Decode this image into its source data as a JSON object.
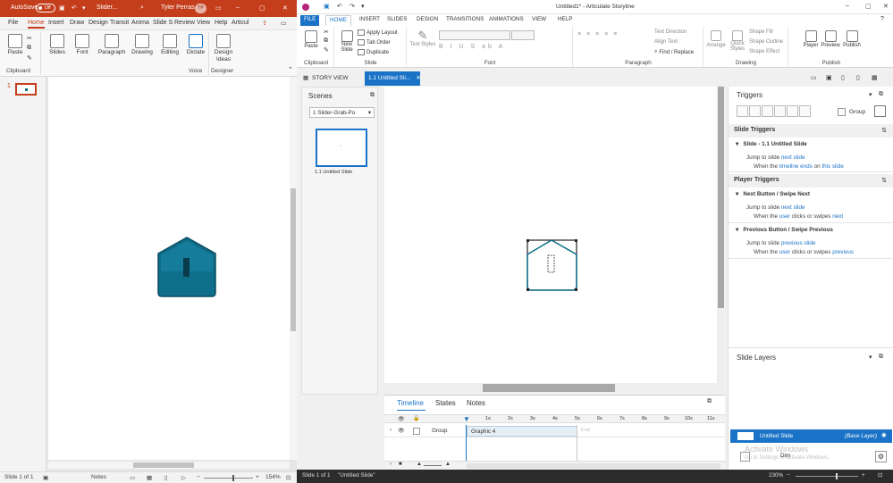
{
  "pp": {
    "titlebar": {
      "autosave": "AutoSave",
      "autosave_state": "Off",
      "doc": "Slider...",
      "user": "Tyler Perras",
      "initials": "TP"
    },
    "tabs": [
      "File",
      "Home",
      "Insert",
      "Draw",
      "Design",
      "Transit",
      "Anima",
      "Slide S",
      "Review",
      "View",
      "Help",
      "Articul"
    ],
    "active_tab": "Home",
    "ribbon": {
      "paste": "Paste",
      "clipboard": "Clipboard",
      "slides": "Slides",
      "font": "Font",
      "paragraph": "Paragraph",
      "drawing": "Drawing",
      "editing": "Editing",
      "dictate": "Dictate",
      "voice": "Voice",
      "design_ideas_1": "Design",
      "design_ideas_2": "Ideas",
      "designer": "Designer"
    },
    "thumb_number": "1",
    "status": {
      "slide": "Slide 1 of 1",
      "notes": "Notes",
      "zoom": "154%"
    },
    "shape_color": "#0f6e8a"
  },
  "sl": {
    "title": "Untitled1* - Articulate Storyline",
    "tabs": [
      "FILE",
      "HOME",
      "INSERT",
      "SLIDES",
      "DESIGN",
      "TRANSITIONS",
      "ANIMATIONS",
      "VIEW",
      "HELP"
    ],
    "active_tab": "HOME",
    "ribbon": {
      "paste": "Paste",
      "clipboard": "Clipboard",
      "new_slide_1": "New",
      "new_slide_2": "Slide",
      "apply_layout": "Apply Layout",
      "tab_order": "Tab Order",
      "duplicate": "Duplicate",
      "slide": "Slide",
      "text_styles": "Text Styles",
      "font": "Font",
      "text_direction": "Text Direction",
      "align_text": "Align Text",
      "find_replace": "Find / Replace",
      "paragraph": "Paragraph",
      "arrange": "Arrange",
      "quick_styles_1": "Quick",
      "quick_styles_2": "Styles",
      "shape_fill": "Shape Fill",
      "shape_outline": "Shape Outline",
      "shape_effect": "Shape Effect",
      "drawing": "Drawing",
      "player": "Player",
      "preview": "Preview",
      "publish_btn": "Publish",
      "publish": "Publish"
    },
    "view_tabs": {
      "story": "STORY VIEW",
      "slide": "1.1 Untitled Sli..."
    },
    "scenes": {
      "title": "Scenes",
      "dropdown": "1 Slider-Grab-Po",
      "thumb_label": "1.1 Untitled Slide"
    },
    "timeline": {
      "tabs": [
        "Timeline",
        "States",
        "Notes"
      ],
      "ticks": [
        "1s",
        "2s",
        "3s",
        "4s",
        "5s",
        "6s",
        "7s",
        "8s",
        "9s",
        "10s",
        "11s"
      ],
      "rows": [
        {
          "name": "Group",
          "bar": "Graphic 4"
        }
      ],
      "end": "End"
    },
    "triggers": {
      "title": "Triggers",
      "group": "Group",
      "slide_triggers": "Slide Triggers",
      "slide_sub": "Slide - 1.1 Untitled Slide",
      "t1_a": "Jump to slide",
      "t1_link": "next slide",
      "t1_b": "When the",
      "t1_link2": "timeline ends",
      "t1_c": "on",
      "t1_link3": "this slide",
      "player_triggers": "Player Triggers",
      "next_sub": "Next Button / Swipe Next",
      "t2_a": "Jump to slide",
      "t2_link": "next slide",
      "t2_b": "When the",
      "t2_link2": "user",
      "t2_c": "clicks or swipes",
      "t2_link3": "next",
      "prev_sub": "Previous Button / Swipe Previous",
      "t3_a": "Jump to slide",
      "t3_link": "previous slide",
      "t3_b": "When the",
      "t3_link2": "user",
      "t3_c": "clicks or swipes",
      "t3_link3": "previous"
    },
    "layers": {
      "title": "Slide Layers",
      "base_name": "Untitled Slide",
      "base_tag": "(Base Layer)",
      "dim": "Dim",
      "watermark": "Activate Windows",
      "watermark_sub": "Go to Settings to activate Windows."
    },
    "status": {
      "slide": "Slide 1 of 1",
      "name": "\"Untitled Slide\"",
      "zoom": "230%"
    }
  }
}
